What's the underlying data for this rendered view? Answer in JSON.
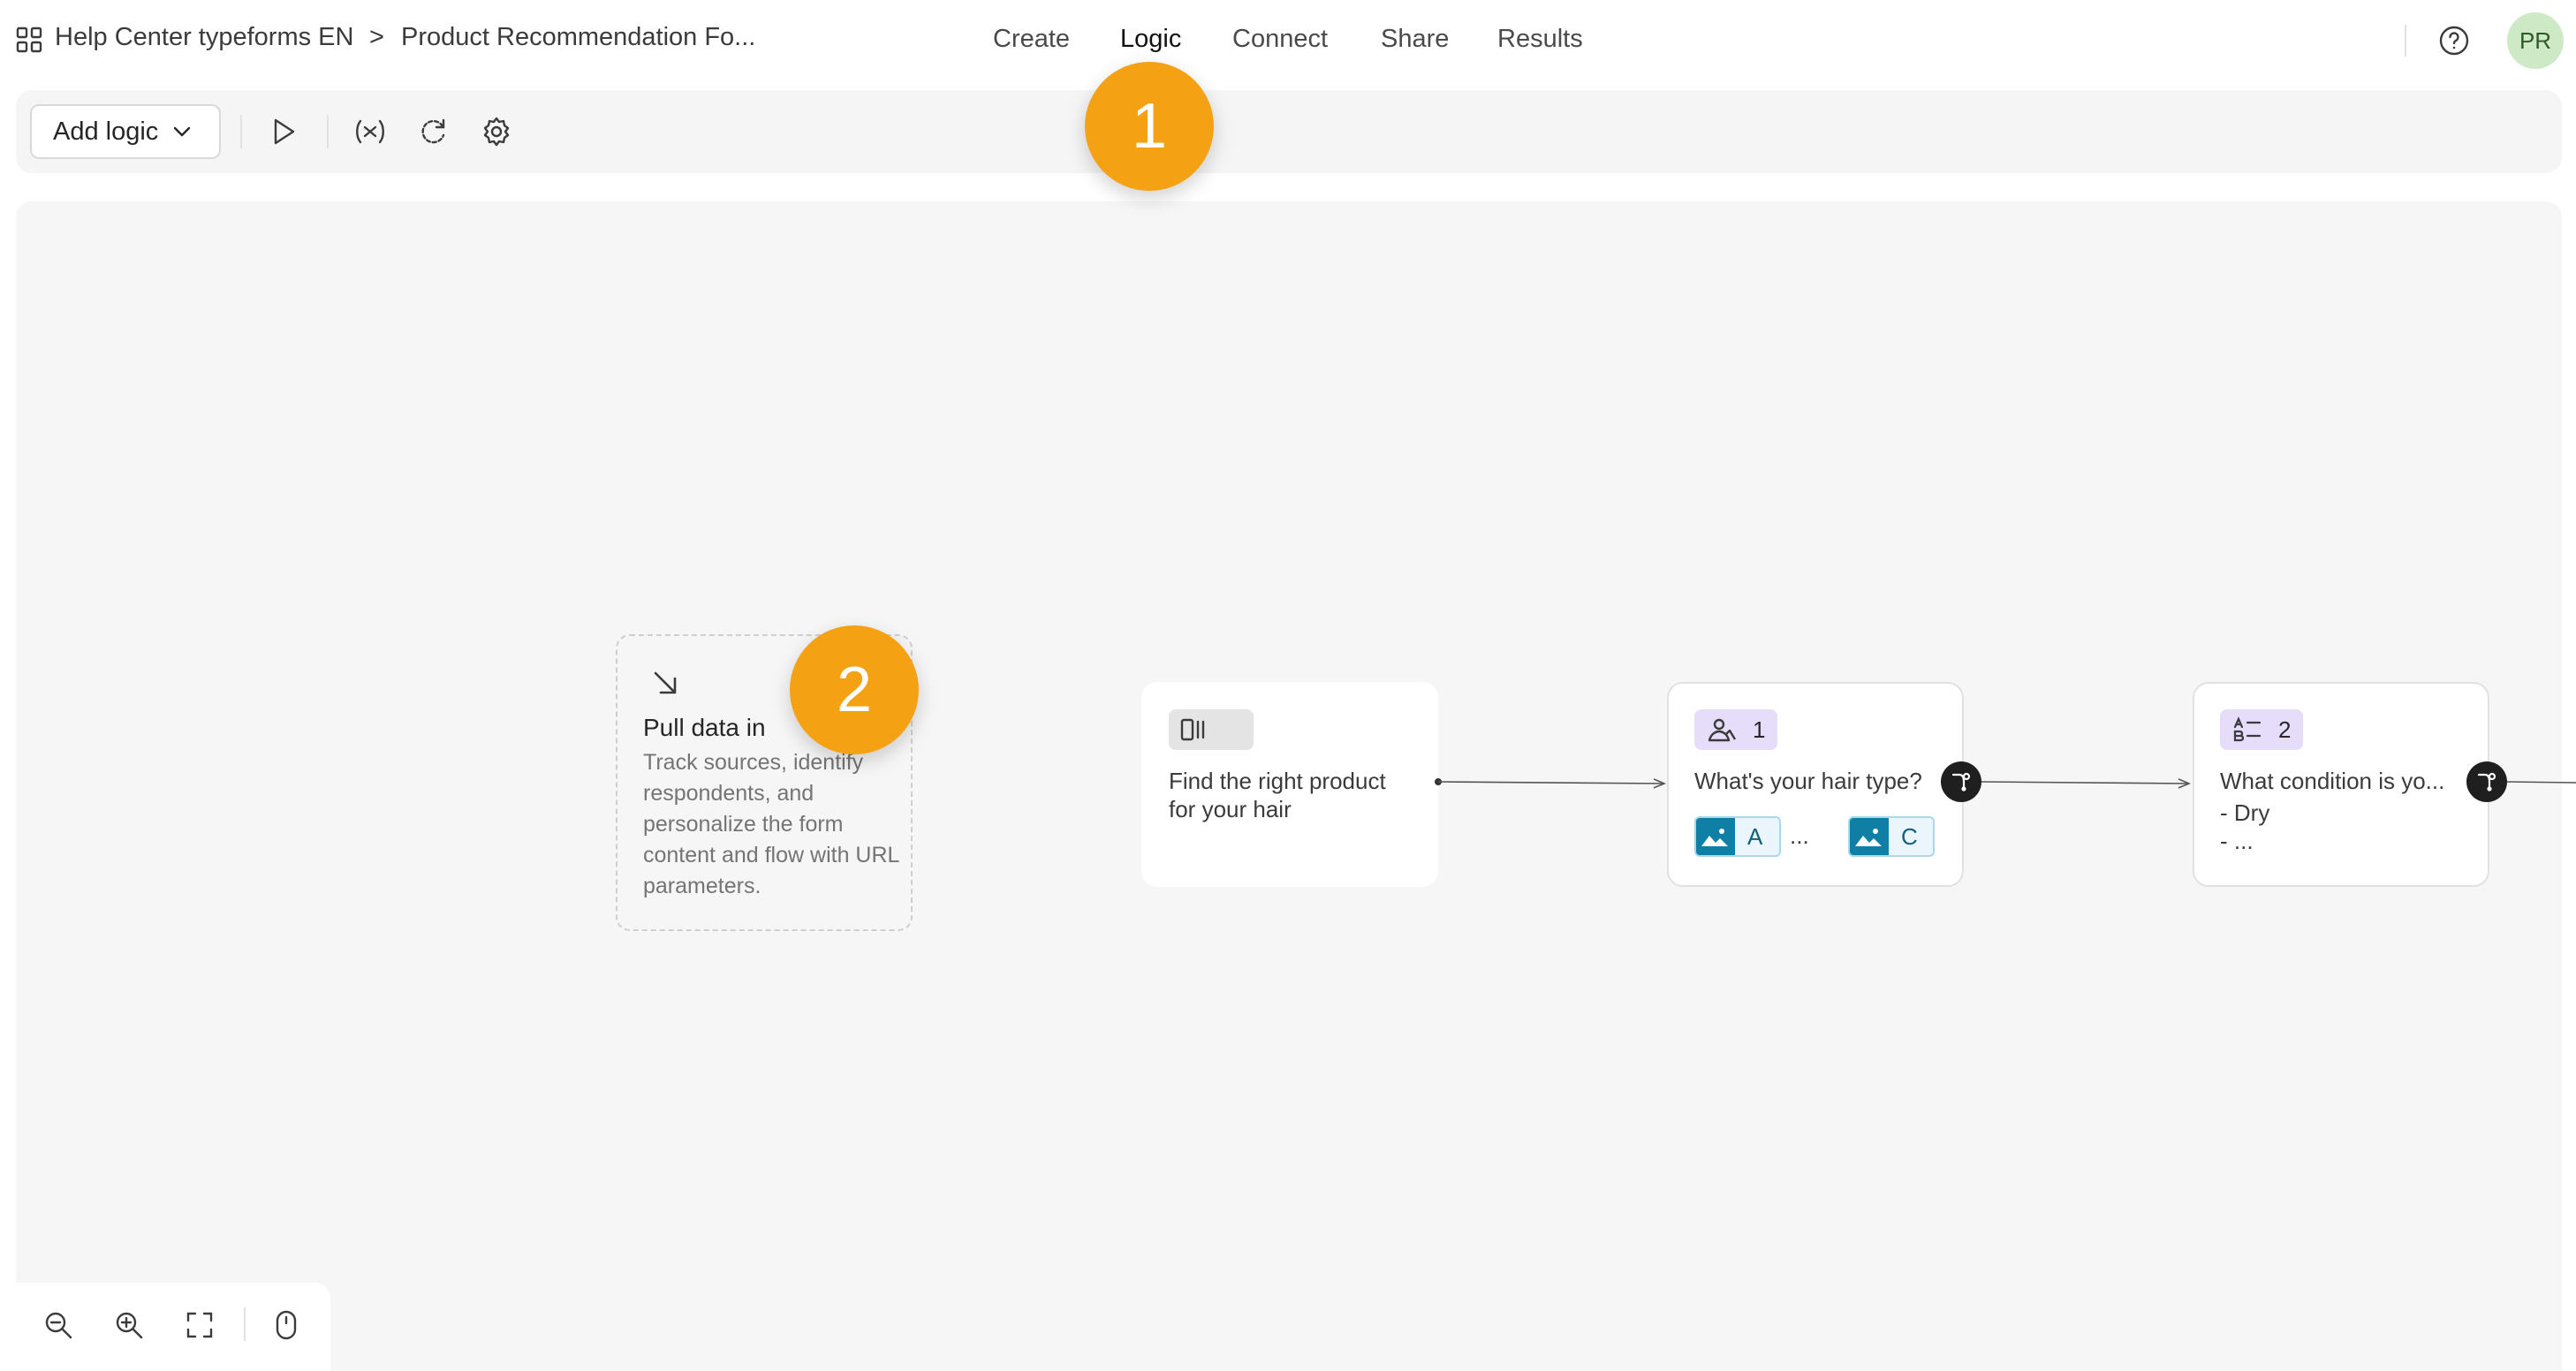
{
  "header": {
    "workspace": "Help Center typeforms EN",
    "separator": ">",
    "form_title": "Product Recommendation Fo...",
    "tabs": [
      {
        "label": "Create"
      },
      {
        "label": "Logic"
      },
      {
        "label": "Connect"
      },
      {
        "label": "Share"
      },
      {
        "label": "Results"
      }
    ],
    "active_tab": "Logic",
    "avatar_initials": "PR",
    "help_icon": "help-circle-icon"
  },
  "toolbar": {
    "add_logic_label": "Add logic",
    "icons": [
      "play-icon",
      "variable-icon",
      "refresh-icon",
      "gear-icon"
    ]
  },
  "callouts": {
    "one": "1",
    "two": "2"
  },
  "canvas": {
    "pull_data": {
      "title": "Pull data in",
      "description": "Track sources, identify respondents, and personalize the form content and flow with URL parameters."
    },
    "welcome": {
      "text_line1": "Find the right product",
      "text_line2": "for your hair"
    },
    "question1": {
      "number": "1",
      "text": "What's your hair type?",
      "choices": [
        "A",
        "C"
      ],
      "ellipsis": "..."
    },
    "question2": {
      "number": "2",
      "text": "What condition is yo...",
      "line1": "- Dry",
      "line2": "- ..."
    }
  },
  "zoom_controls": [
    "zoom-out-icon",
    "zoom-in-icon",
    "fit-screen-icon",
    "mouse-icon"
  ],
  "colors": {
    "accent_badge": "#f5a114",
    "question_badge": "#e6ddfb",
    "choice_image": "#0f7fa6",
    "avatar_bg": "#cde9c6"
  }
}
